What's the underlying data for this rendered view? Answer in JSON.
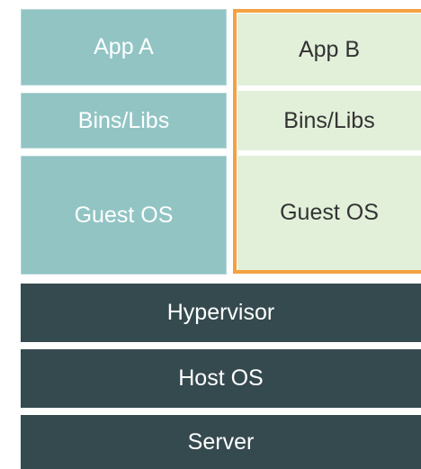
{
  "vm_a": {
    "app": "App A",
    "bins": "Bins/Libs",
    "guest_os": "Guest OS"
  },
  "vm_b": {
    "app": "App B",
    "bins": "Bins/Libs",
    "guest_os": "Guest OS"
  },
  "infrastructure": {
    "hypervisor": "Hypervisor",
    "host_os": "Host OS",
    "server": "Server"
  },
  "colors": {
    "vm_a_fill": "#92c4c4",
    "vm_b_fill": "#e2f0da",
    "vm_b_highlight": "#f5a142",
    "infra_fill": "#354a4f"
  }
}
